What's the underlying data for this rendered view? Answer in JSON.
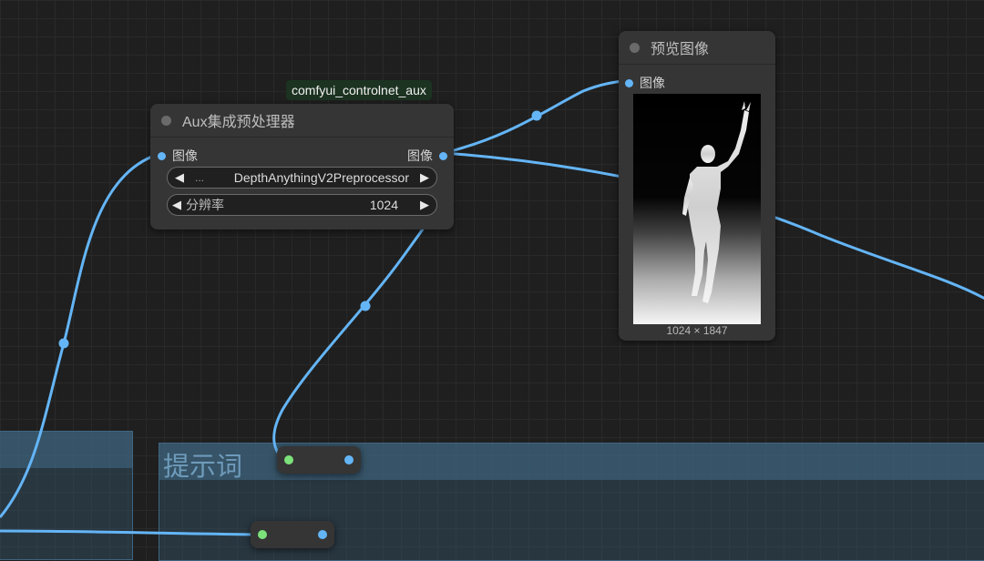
{
  "colors": {
    "canvas_bg": "#1f1f1f",
    "link": "#64b5f6",
    "node_bg": "#353535",
    "group_bg": "#3a627d",
    "badge_bg": "#1c3321",
    "input_slot": "#7ce27a"
  },
  "groups": [
    {
      "title": ""
    },
    {
      "title": "提示词"
    }
  ],
  "aux_node": {
    "badge": "comfyui_controlnet_aux",
    "title": "Aux集成预处理器",
    "input_label": "图像",
    "output_label": "图像",
    "preprocessor": {
      "prefix": "...",
      "value": "DepthAnythingV2Preprocessor"
    },
    "resolution": {
      "label": "分辨率",
      "value": "1024"
    }
  },
  "preview_node": {
    "title": "预览图像",
    "input_label": "图像",
    "image_size": "1024 × 1847"
  },
  "reroutes": [
    {
      "name": "reroute-1"
    },
    {
      "name": "reroute-2"
    }
  ],
  "icons": {
    "widget_left": "◀",
    "widget_right": "▶"
  }
}
